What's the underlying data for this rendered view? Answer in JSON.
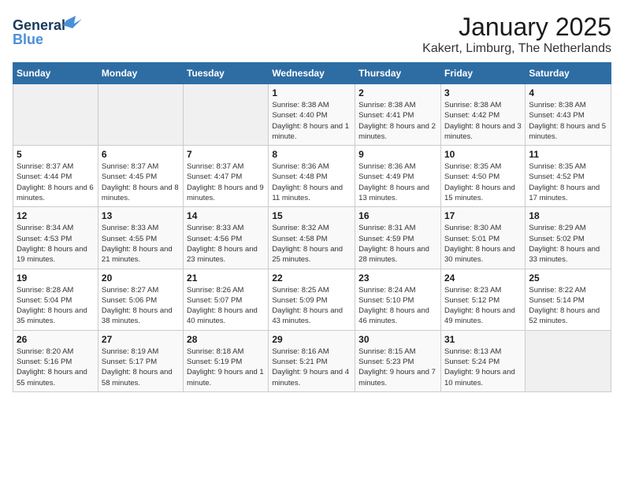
{
  "logo": {
    "text_general": "General",
    "text_blue": "Blue"
  },
  "title": "January 2025",
  "subtitle": "Kakert, Limburg, The Netherlands",
  "weekdays": [
    "Sunday",
    "Monday",
    "Tuesday",
    "Wednesday",
    "Thursday",
    "Friday",
    "Saturday"
  ],
  "weeks": [
    [
      {
        "day": "",
        "detail": ""
      },
      {
        "day": "",
        "detail": ""
      },
      {
        "day": "",
        "detail": ""
      },
      {
        "day": "1",
        "detail": "Sunrise: 8:38 AM\nSunset: 4:40 PM\nDaylight: 8 hours\nand 1 minute."
      },
      {
        "day": "2",
        "detail": "Sunrise: 8:38 AM\nSunset: 4:41 PM\nDaylight: 8 hours\nand 2 minutes."
      },
      {
        "day": "3",
        "detail": "Sunrise: 8:38 AM\nSunset: 4:42 PM\nDaylight: 8 hours\nand 3 minutes."
      },
      {
        "day": "4",
        "detail": "Sunrise: 8:38 AM\nSunset: 4:43 PM\nDaylight: 8 hours\nand 5 minutes."
      }
    ],
    [
      {
        "day": "5",
        "detail": "Sunrise: 8:37 AM\nSunset: 4:44 PM\nDaylight: 8 hours\nand 6 minutes."
      },
      {
        "day": "6",
        "detail": "Sunrise: 8:37 AM\nSunset: 4:45 PM\nDaylight: 8 hours\nand 8 minutes."
      },
      {
        "day": "7",
        "detail": "Sunrise: 8:37 AM\nSunset: 4:47 PM\nDaylight: 8 hours\nand 9 minutes."
      },
      {
        "day": "8",
        "detail": "Sunrise: 8:36 AM\nSunset: 4:48 PM\nDaylight: 8 hours\nand 11 minutes."
      },
      {
        "day": "9",
        "detail": "Sunrise: 8:36 AM\nSunset: 4:49 PM\nDaylight: 8 hours\nand 13 minutes."
      },
      {
        "day": "10",
        "detail": "Sunrise: 8:35 AM\nSunset: 4:50 PM\nDaylight: 8 hours\nand 15 minutes."
      },
      {
        "day": "11",
        "detail": "Sunrise: 8:35 AM\nSunset: 4:52 PM\nDaylight: 8 hours\nand 17 minutes."
      }
    ],
    [
      {
        "day": "12",
        "detail": "Sunrise: 8:34 AM\nSunset: 4:53 PM\nDaylight: 8 hours\nand 19 minutes."
      },
      {
        "day": "13",
        "detail": "Sunrise: 8:33 AM\nSunset: 4:55 PM\nDaylight: 8 hours\nand 21 minutes."
      },
      {
        "day": "14",
        "detail": "Sunrise: 8:33 AM\nSunset: 4:56 PM\nDaylight: 8 hours\nand 23 minutes."
      },
      {
        "day": "15",
        "detail": "Sunrise: 8:32 AM\nSunset: 4:58 PM\nDaylight: 8 hours\nand 25 minutes."
      },
      {
        "day": "16",
        "detail": "Sunrise: 8:31 AM\nSunset: 4:59 PM\nDaylight: 8 hours\nand 28 minutes."
      },
      {
        "day": "17",
        "detail": "Sunrise: 8:30 AM\nSunset: 5:01 PM\nDaylight: 8 hours\nand 30 minutes."
      },
      {
        "day": "18",
        "detail": "Sunrise: 8:29 AM\nSunset: 5:02 PM\nDaylight: 8 hours\nand 33 minutes."
      }
    ],
    [
      {
        "day": "19",
        "detail": "Sunrise: 8:28 AM\nSunset: 5:04 PM\nDaylight: 8 hours\nand 35 minutes."
      },
      {
        "day": "20",
        "detail": "Sunrise: 8:27 AM\nSunset: 5:06 PM\nDaylight: 8 hours\nand 38 minutes."
      },
      {
        "day": "21",
        "detail": "Sunrise: 8:26 AM\nSunset: 5:07 PM\nDaylight: 8 hours\nand 40 minutes."
      },
      {
        "day": "22",
        "detail": "Sunrise: 8:25 AM\nSunset: 5:09 PM\nDaylight: 8 hours\nand 43 minutes."
      },
      {
        "day": "23",
        "detail": "Sunrise: 8:24 AM\nSunset: 5:10 PM\nDaylight: 8 hours\nand 46 minutes."
      },
      {
        "day": "24",
        "detail": "Sunrise: 8:23 AM\nSunset: 5:12 PM\nDaylight: 8 hours\nand 49 minutes."
      },
      {
        "day": "25",
        "detail": "Sunrise: 8:22 AM\nSunset: 5:14 PM\nDaylight: 8 hours\nand 52 minutes."
      }
    ],
    [
      {
        "day": "26",
        "detail": "Sunrise: 8:20 AM\nSunset: 5:16 PM\nDaylight: 8 hours\nand 55 minutes."
      },
      {
        "day": "27",
        "detail": "Sunrise: 8:19 AM\nSunset: 5:17 PM\nDaylight: 8 hours\nand 58 minutes."
      },
      {
        "day": "28",
        "detail": "Sunrise: 8:18 AM\nSunset: 5:19 PM\nDaylight: 9 hours\nand 1 minute."
      },
      {
        "day": "29",
        "detail": "Sunrise: 8:16 AM\nSunset: 5:21 PM\nDaylight: 9 hours\nand 4 minutes."
      },
      {
        "day": "30",
        "detail": "Sunrise: 8:15 AM\nSunset: 5:23 PM\nDaylight: 9 hours\nand 7 minutes."
      },
      {
        "day": "31",
        "detail": "Sunrise: 8:13 AM\nSunset: 5:24 PM\nDaylight: 9 hours\nand 10 minutes."
      },
      {
        "day": "",
        "detail": ""
      }
    ]
  ]
}
